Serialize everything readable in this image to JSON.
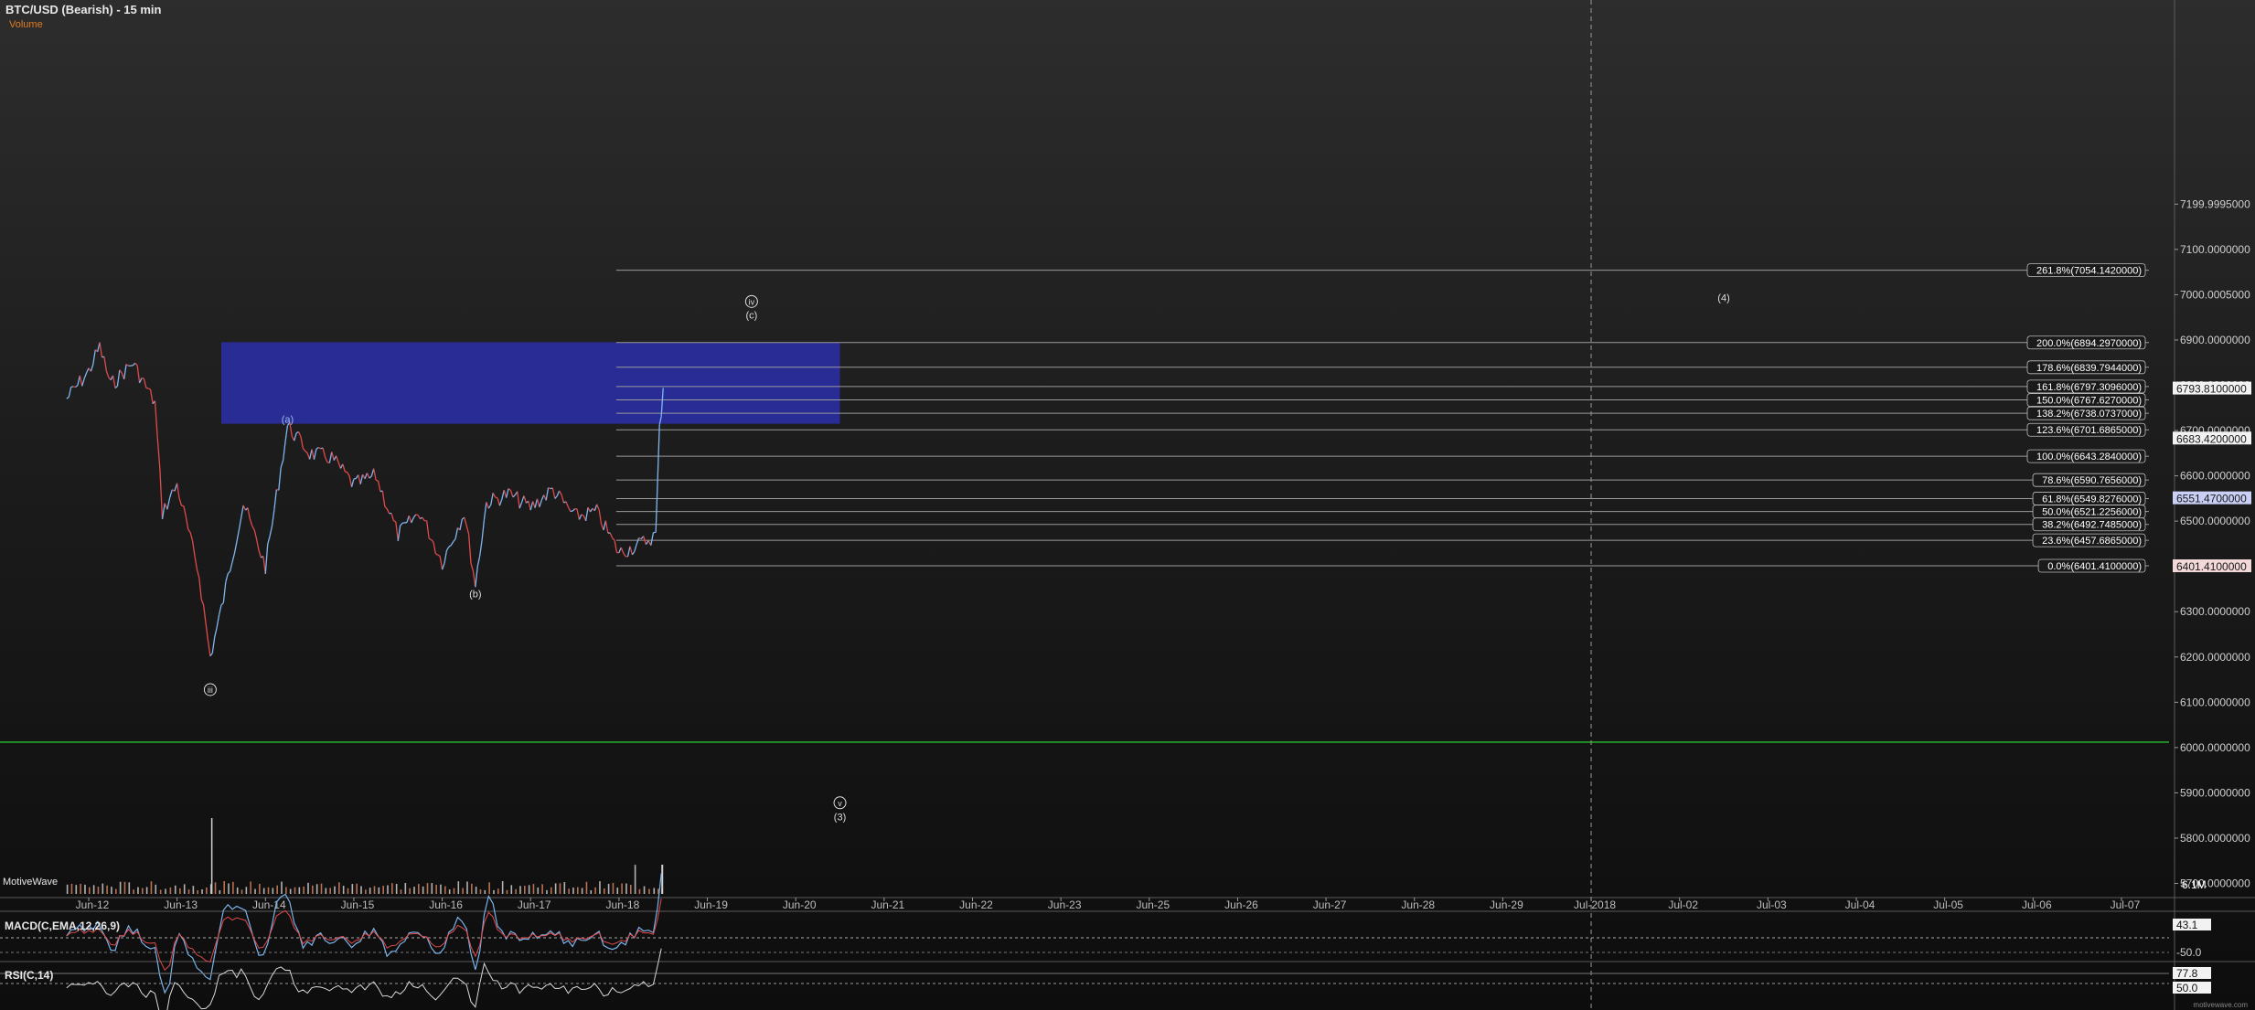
{
  "header": {
    "title": "BTC/USD (Bearish) - 15 min",
    "volume_label": "Volume"
  },
  "watermark": "MotiveWave",
  "credit": "motivewave.com",
  "chart_data": {
    "type": "line",
    "title": "BTC/USD (Bearish) - 15 min",
    "ylim": [
      5620,
      7240
    ],
    "y_ticks": [
      {
        "v": 7199.9995,
        "label": "7199.9995000"
      },
      {
        "v": 7100,
        "label": "7100.0000000"
      },
      {
        "v": 7000.0005,
        "label": "7000.0005000"
      },
      {
        "v": 6900,
        "label": "6900.0000000"
      },
      {
        "v": 6800,
        "label": "6800.0000000"
      },
      {
        "v": 6700,
        "label": "6700.0000000"
      },
      {
        "v": 6600,
        "label": "6600.0000000"
      },
      {
        "v": 6500,
        "label": "6500.0000000"
      },
      {
        "v": 6400,
        "label": "6400.0000000"
      },
      {
        "v": 6300,
        "label": "6300.0000000"
      },
      {
        "v": 6200,
        "label": "6200.0000000"
      },
      {
        "v": 6100,
        "label": "6100.0000000"
      },
      {
        "v": 6000,
        "label": "6000.0000000"
      },
      {
        "v": 5900,
        "label": "5900.0000000"
      },
      {
        "v": 5800,
        "label": "5800.0000000"
      },
      {
        "v": 5700,
        "label": "5700.0000000"
      }
    ],
    "x_ticks": [
      "Jun-12",
      "Jun-13",
      "Jun-14",
      "Jun-15",
      "Jun-16",
      "Jun-17",
      "Jun-18",
      "Jun-19",
      "Jun-20",
      "Jun-21",
      "Jun-22",
      "Jun-23",
      "Jun-25",
      "Jun-26",
      "Jun-27",
      "Jun-28",
      "Jun-29",
      "Jul-2018",
      "Jul-02",
      "Jul-03",
      "Jul-04",
      "Jul-05",
      "Jul-06",
      "Jul-07"
    ],
    "price_path": [
      [
        "Jun-11 18:00",
        6770
      ],
      [
        "Jun-12 00:00",
        6830
      ],
      [
        "Jun-12 03:00",
        6885
      ],
      [
        "Jun-12 06:00",
        6800
      ],
      [
        "Jun-12 12:00",
        6850
      ],
      [
        "Jun-12 18:00",
        6760
      ],
      [
        "Jun-12 20:00",
        6520
      ],
      [
        "Jun-13 00:00",
        6580
      ],
      [
        "Jun-13 06:00",
        6380
      ],
      [
        "Jun-13 09:00",
        6200
      ],
      [
        "Jun-13 12:00",
        6305
      ],
      [
        "Jun-13 18:00",
        6540
      ],
      [
        "Jun-14 00:00",
        6400
      ],
      [
        "Jun-14 06:00",
        6710
      ],
      [
        "Jun-14 12:00",
        6650
      ],
      [
        "Jun-14 18:00",
        6640
      ],
      [
        "Jun-15 00:00",
        6580
      ],
      [
        "Jun-15 06:00",
        6600
      ],
      [
        "Jun-15 12:00",
        6470
      ],
      [
        "Jun-15 18:00",
        6520
      ],
      [
        "Jun-16 00:00",
        6410
      ],
      [
        "Jun-16 06:00",
        6520
      ],
      [
        "Jun-16 09:00",
        6360
      ],
      [
        "Jun-16 12:00",
        6540
      ],
      [
        "Jun-16 18:00",
        6560
      ],
      [
        "Jun-17 00:00",
        6530
      ],
      [
        "Jun-17 06:00",
        6570
      ],
      [
        "Jun-17 12:00",
        6510
      ],
      [
        "Jun-17 18:00",
        6520
      ],
      [
        "Jun-18 00:00",
        6430
      ],
      [
        "Jun-18 06:00",
        6450
      ],
      [
        "Jun-18 10:00",
        6470
      ],
      [
        "Jun-18 11:00",
        6700
      ],
      [
        "Jun-18 12:00",
        6794
      ]
    ],
    "fib_levels": [
      {
        "label": "261.8%(7054.1420000)",
        "v": 7054.142
      },
      {
        "label": "200.0%(6894.2970000)",
        "v": 6894.297
      },
      {
        "label": "178.6%(6839.7944000)",
        "v": 6839.7944
      },
      {
        "label": "161.8%(6797.3096000)",
        "v": 6797.3096
      },
      {
        "label": "150.0%(6767.6270000)",
        "v": 6767.627
      },
      {
        "label": "138.2%(6738.0737000)",
        "v": 6738.0737
      },
      {
        "label": "123.6%(6701.6865000)",
        "v": 6701.6865
      },
      {
        "label": "100.0%(6643.2840000)",
        "v": 6643.284
      },
      {
        "label": "78.6%(6590.7656000)",
        "v": 6590.7656
      },
      {
        "label": "61.8%(6549.8276000)",
        "v": 6549.8276
      },
      {
        "label": "50.0%(6521.2256000)",
        "v": 6521.2256
      },
      {
        "label": "38.2%(6492.7485000)",
        "v": 6492.7485
      },
      {
        "label": "23.6%(6457.6865000)",
        "v": 6457.6865
      },
      {
        "label": "0.0%(6401.4100000)",
        "v": 6401.41
      }
    ],
    "target_zone": {
      "from": 6715,
      "to": 6895,
      "start": "Jun-13 12:00",
      "end": "Jun-20 12:00"
    },
    "support_line": 6012,
    "dashed_vertical": "Jul-2018",
    "price_markers": [
      {
        "label": "6793.8100000",
        "v": 6793.81,
        "color": "#ffffff"
      },
      {
        "label": "6683.4200000",
        "v": 6683.42,
        "color": "#ffffff"
      },
      {
        "label": "6551.4700000",
        "v": 6551.47,
        "color": "#c9cff5"
      },
      {
        "label": "6401.4100000",
        "v": 6401.41,
        "color": "#f2d8d8"
      }
    ],
    "wave_labels": [
      {
        "text": "(a)",
        "at": "Jun-14 06:00",
        "v": 6725,
        "circle": false,
        "color": "#9ab8e8"
      },
      {
        "text": "(b)",
        "at": "Jun-16 09:00",
        "v": 6340,
        "circle": false,
        "color": "#dddddd"
      },
      {
        "text": "iii",
        "at": "Jun-13 09:00",
        "v": 6128,
        "circle": true,
        "color": "#dddddd"
      },
      {
        "text": "iv",
        "at": "Jun-19 12:00",
        "v": 6985,
        "circle": true,
        "color": "#dddddd"
      },
      {
        "text": "(c)",
        "at": "Jun-19 12:00",
        "v": 6955,
        "circle": false,
        "color": "#dddddd"
      },
      {
        "text": "(4)",
        "at": "Jul-02 12:00",
        "v": 6994,
        "circle": false,
        "color": "#dddddd"
      },
      {
        "text": "v",
        "at": "Jun-20 12:00",
        "v": 5878,
        "circle": true,
        "color": "#dddddd"
      },
      {
        "text": "(3)",
        "at": "Jun-20 12:00",
        "v": 5847,
        "circle": false,
        "color": "#dddddd"
      }
    ],
    "volume_axis_label": "6.1M",
    "macd": {
      "label": "MACD(C,EMA,12,26,9)",
      "last": "43.1",
      "level_label": "-50.0"
    },
    "rsi": {
      "label": "RSI(C,14)",
      "last": "77.8",
      "mid": "50.0"
    }
  }
}
